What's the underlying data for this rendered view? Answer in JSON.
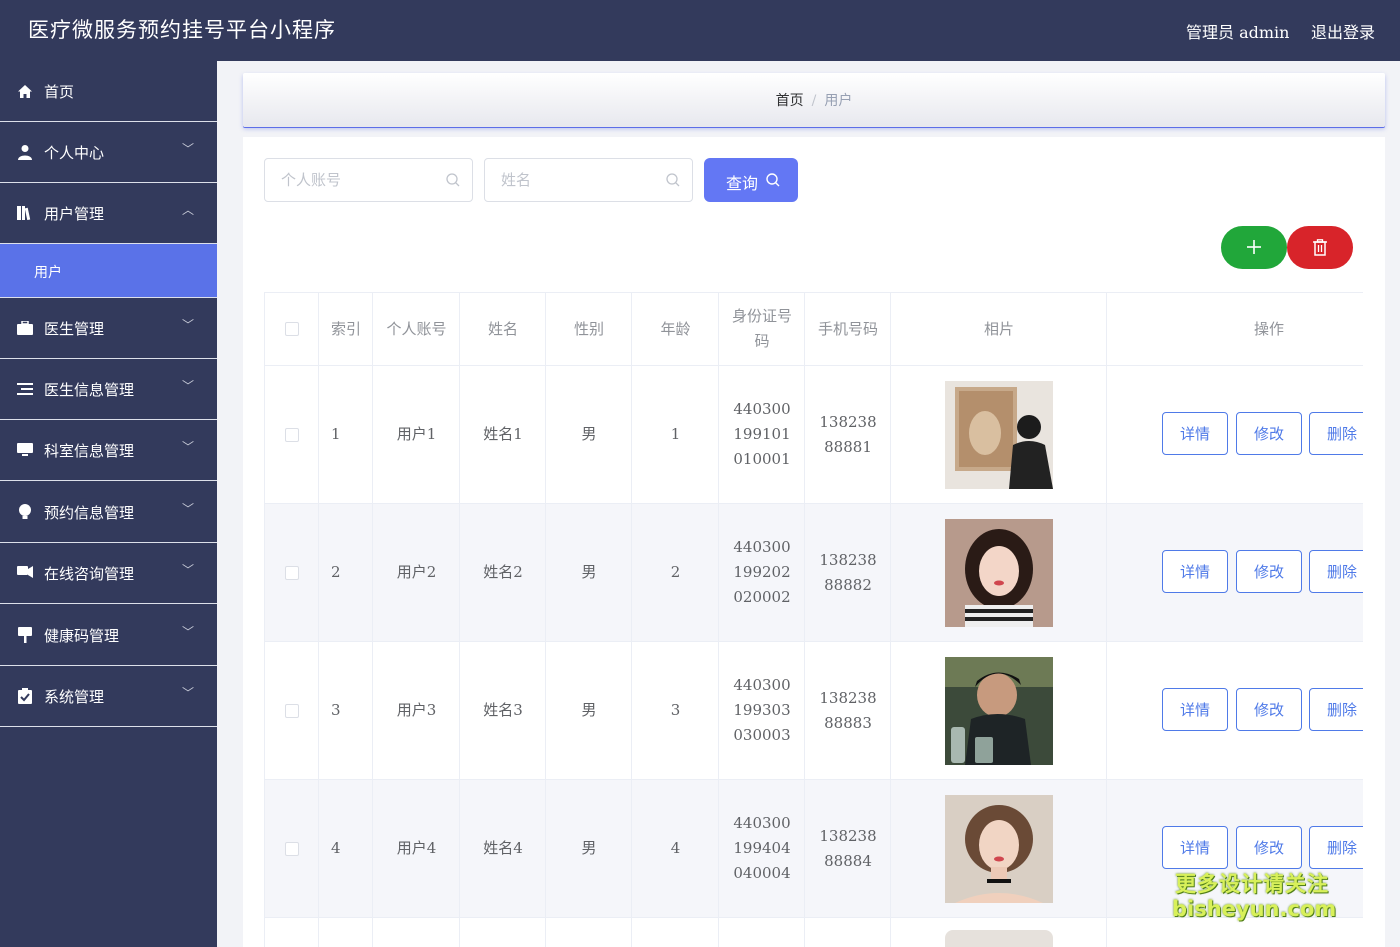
{
  "header": {
    "title": "医疗微服务预约挂号平台小程序",
    "user": "管理员 admin",
    "logout": "退出登录"
  },
  "sidebar": {
    "items": [
      {
        "label": "首页",
        "icon": "home-icon"
      },
      {
        "label": "个人中心",
        "icon": "person-icon"
      },
      {
        "label": "用户管理",
        "icon": "book-icon",
        "expanded": true
      },
      {
        "label": "医生管理",
        "icon": "briefcase-icon"
      },
      {
        "label": "医生信息管理",
        "icon": "list-icon"
      },
      {
        "label": "科室信息管理",
        "icon": "monitor-icon"
      },
      {
        "label": "预约信息管理",
        "icon": "bulb-icon"
      },
      {
        "label": "在线咨询管理",
        "icon": "chat-icon"
      },
      {
        "label": "健康码管理",
        "icon": "qr-icon"
      },
      {
        "label": "系统管理",
        "icon": "check-icon"
      }
    ],
    "submenu": {
      "label": "用户"
    }
  },
  "breadcrumb": {
    "home": "首页",
    "separator": "/",
    "current": "用户"
  },
  "search": {
    "account_placeholder": "个人账号",
    "name_placeholder": "姓名",
    "query_label": "查询"
  },
  "colors": {
    "accent": "#6377f4",
    "sidebar": "#333a5c",
    "add": "#21a73a",
    "delete": "#d8242a"
  },
  "table": {
    "headers": [
      "索引",
      "个人账号",
      "姓名",
      "性别",
      "年龄",
      "身份证号码",
      "手机号码",
      "相片",
      "操作"
    ],
    "actions": {
      "detail": "详情",
      "edit": "修改",
      "delete": "删除"
    },
    "rows": [
      {
        "index": "1",
        "account": "用户1",
        "name": "姓名1",
        "gender": "男",
        "age": "1",
        "id_number": "440300199101010001",
        "phone": "13823888881"
      },
      {
        "index": "2",
        "account": "用户2",
        "name": "姓名2",
        "gender": "男",
        "age": "2",
        "id_number": "440300199202020002",
        "phone": "13823888882"
      },
      {
        "index": "3",
        "account": "用户3",
        "name": "姓名3",
        "gender": "男",
        "age": "3",
        "id_number": "440300199303030003",
        "phone": "13823888883"
      },
      {
        "index": "4",
        "account": "用户4",
        "name": "姓名4",
        "gender": "男",
        "age": "4",
        "id_number": "440300199404040004",
        "phone": "13823888884"
      }
    ]
  },
  "watermark": {
    "line1": "更多设计请关注",
    "line2": "bisheyun.com"
  }
}
